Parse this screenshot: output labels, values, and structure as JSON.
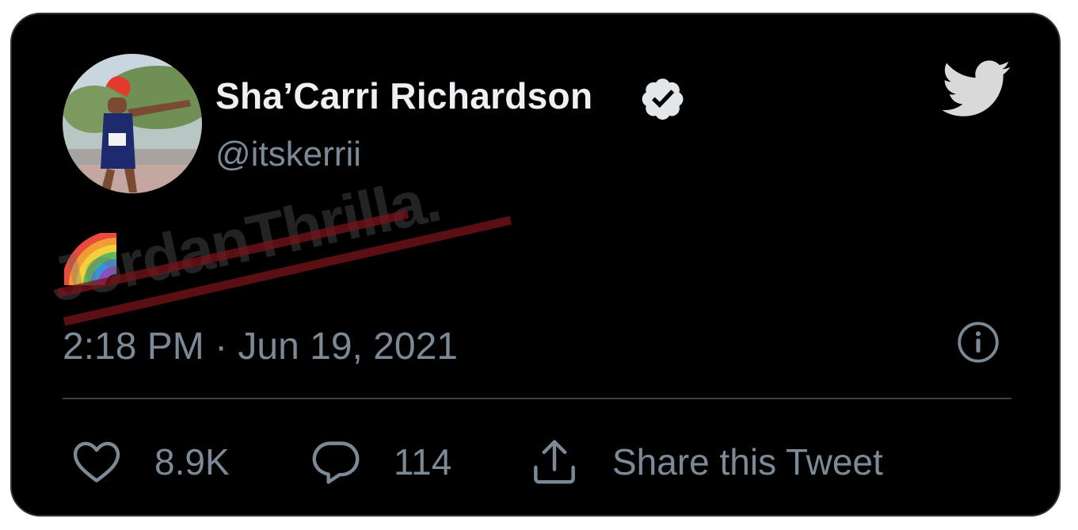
{
  "user": {
    "display_name": "Sha’Carri Richardson",
    "handle": "@itskerrii",
    "verified": true,
    "avatar": "profile-photo"
  },
  "tweet": {
    "text_emoji": "rainbow-emoji",
    "timestamp": "2:18 PM · Jun 19, 2021"
  },
  "actions": {
    "like_count": "8.9K",
    "reply_count": "114",
    "share_label": "Share this Tweet"
  },
  "watermark": {
    "text": "JordanThrilla."
  },
  "icons": {
    "brand": "twitter-bird-icon",
    "info": "info-icon",
    "like": "heart-icon",
    "reply": "speech-bubble-icon",
    "share": "share-upload-icon"
  },
  "colors": {
    "card_background": "#000000",
    "text_primary": "#eef1f3",
    "text_secondary": "#7c8a97",
    "bird": "#d9d9d9"
  }
}
